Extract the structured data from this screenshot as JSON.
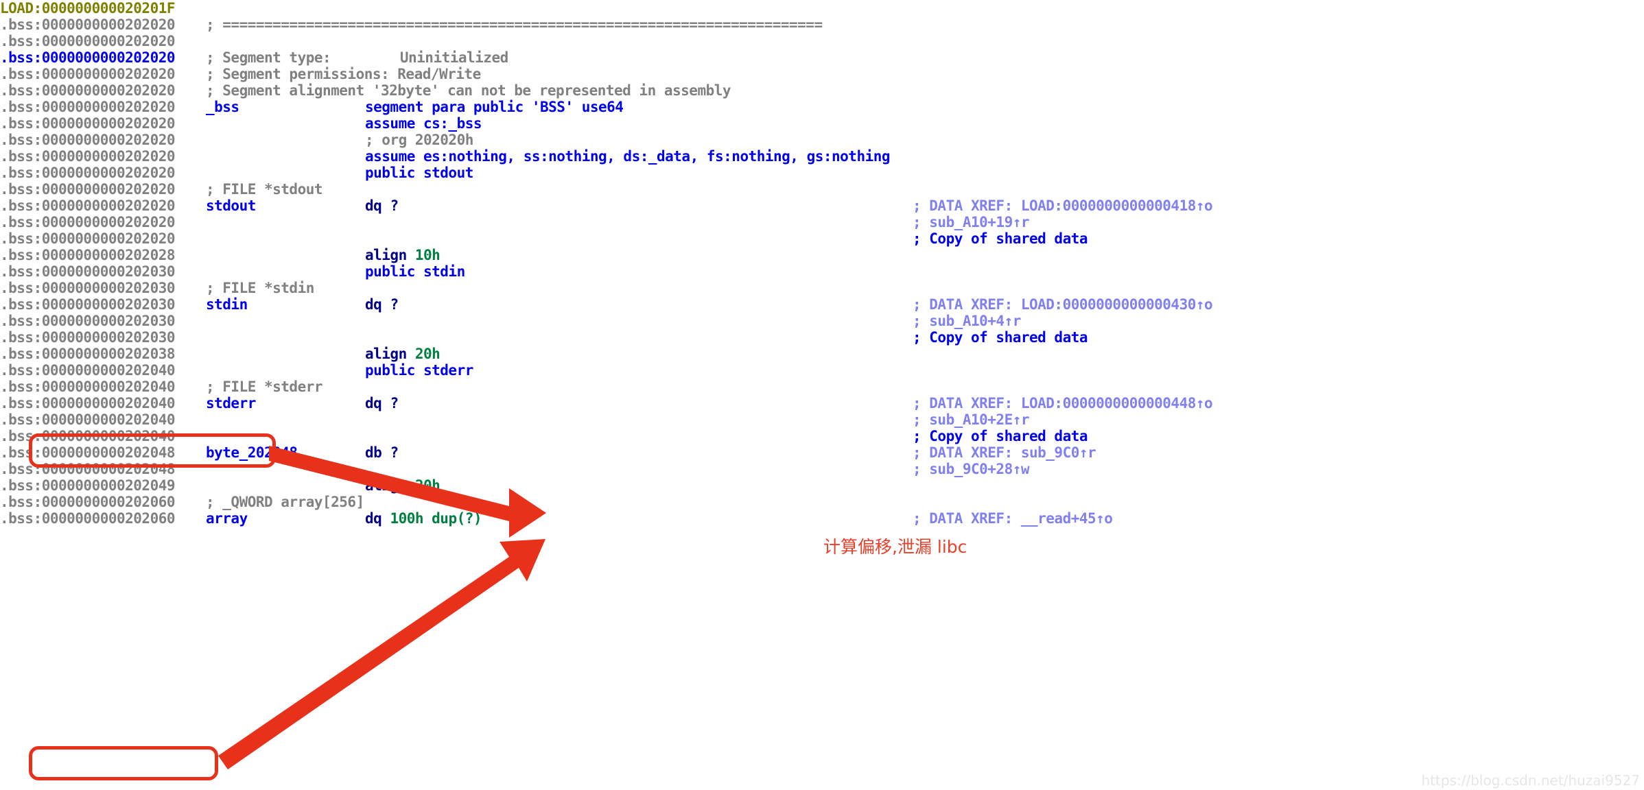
{
  "watermark": "https://blog.csdn.net/huzai9527",
  "annotations": {
    "note_zh": "计算偏移,泄漏 libc",
    "accent_color": "#e8311a"
  },
  "colors": {
    "address": "#808080",
    "address_highlight": "#0000ee",
    "address_olive": "#808000",
    "comment": "#808080",
    "keyword": "#0000ee",
    "mnemonic": "#00008b",
    "number": "#008040",
    "xref": "#8080f0",
    "repeatable_comment": "#0000ee",
    "background": "#ffffff"
  },
  "listing": {
    "lines": [
      {
        "addr": "LOAD:000000000020201F",
        "addr_style": "olive",
        "body": ""
      },
      {
        "addr": ".bss:0000000000202020",
        "comment": "; ========================================================================"
      },
      {
        "addr": ".bss:0000000000202020",
        "body": ""
      },
      {
        "addr": ".bss:0000000000202020",
        "addr_style": "blue",
        "comment": "; Segment type:\tUninitialized"
      },
      {
        "addr": ".bss:0000000000202020",
        "comment": "; Segment permissions: Read/Write"
      },
      {
        "addr": ".bss:0000000000202020",
        "comment": "; Segment alignment '32byte' can not be represented in assembly"
      },
      {
        "addr": ".bss:0000000000202020",
        "name": "_bss",
        "instr": "segment para public 'BSS' use64"
      },
      {
        "addr": ".bss:0000000000202020",
        "instr": "assume cs:_bss"
      },
      {
        "addr": ".bss:0000000000202020",
        "comment_indent": "; org 202020h"
      },
      {
        "addr": ".bss:0000000000202020",
        "instr": "assume es:nothing, ss:nothing, ds:_data, fs:nothing, gs:nothing"
      },
      {
        "addr": ".bss:0000000000202020",
        "instr": "public stdout"
      },
      {
        "addr": ".bss:0000000000202020",
        "comment": "; FILE *stdout"
      },
      {
        "addr": ".bss:0000000000202020",
        "name": "stdout",
        "mnemonic": "dq",
        "operand": "?",
        "xref": "; DATA XREF: LOAD:0000000000000418↑o"
      },
      {
        "addr": ".bss:0000000000202020",
        "xref": "; sub_A10+19↑r"
      },
      {
        "addr": ".bss:0000000000202020",
        "xref_bold": "; Copy of shared data"
      },
      {
        "addr": ".bss:0000000000202028",
        "mnemonic": "align",
        "operand": "10h"
      },
      {
        "addr": ".bss:0000000000202030",
        "instr": "public stdin"
      },
      {
        "addr": ".bss:0000000000202030",
        "comment": "; FILE *stdin"
      },
      {
        "addr": ".bss:0000000000202030",
        "name": "stdin",
        "mnemonic": "dq",
        "operand": "?",
        "xref": "; DATA XREF: LOAD:0000000000000430↑o"
      },
      {
        "addr": ".bss:0000000000202030",
        "xref": "; sub_A10+4↑r"
      },
      {
        "addr": ".bss:0000000000202030",
        "xref_bold": "; Copy of shared data"
      },
      {
        "addr": ".bss:0000000000202038",
        "mnemonic": "align",
        "operand": "20h"
      },
      {
        "addr": ".bss:0000000000202040",
        "instr": "public stderr"
      },
      {
        "addr": ".bss:0000000000202040",
        "comment": "; FILE *stderr"
      },
      {
        "addr": ".bss:0000000000202040",
        "name": "stderr",
        "mnemonic": "dq",
        "operand": "?",
        "xref": "; DATA XREF: LOAD:0000000000000448↑o"
      },
      {
        "addr": ".bss:0000000000202040",
        "xref": "; sub_A10+2E↑r"
      },
      {
        "addr": ".bss:0000000000202040",
        "xref_bold": "; Copy of shared data"
      },
      {
        "addr": ".bss:0000000000202048",
        "name": "byte_202048",
        "mnemonic": "db",
        "operand": "?",
        "xref": "; DATA XREF: sub_9C0↑r"
      },
      {
        "addr": ".bss:0000000000202048",
        "xref": "; sub_9C0+28↑w"
      },
      {
        "addr": ".bss:0000000000202049",
        "mnemonic": "align",
        "operand": "20h"
      },
      {
        "addr": ".bss:0000000000202060",
        "comment": "; _QWORD array[256]"
      },
      {
        "addr": ".bss:0000000000202060",
        "name": "array",
        "mnemonic": "dq",
        "operand": "100h dup(?)",
        "xref": "; DATA XREF: __read+45↑o"
      }
    ]
  }
}
